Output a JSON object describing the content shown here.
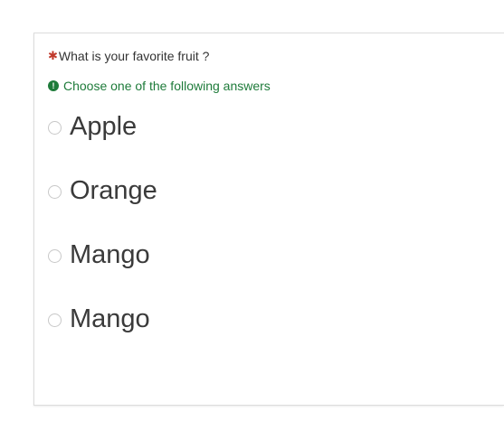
{
  "question": {
    "required_marker": "✱",
    "text": "What is your favorite fruit ?",
    "help_icon": "exclamation-circle-icon",
    "help_text": "Choose one of the following answers"
  },
  "answers": [
    {
      "label": "Apple",
      "selected": false
    },
    {
      "label": "Orange",
      "selected": false
    },
    {
      "label": "Mango",
      "selected": false
    },
    {
      "label": "Mango",
      "selected": false
    }
  ],
  "colors": {
    "required": "#c0392b",
    "help": "#1e7b3a",
    "text": "#333333",
    "border": "#dcdcdc"
  }
}
